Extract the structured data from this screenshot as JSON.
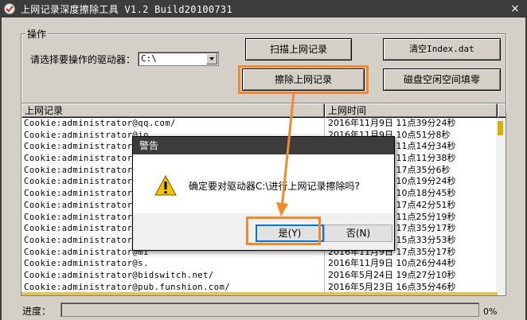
{
  "window": {
    "title": "上网记录深度擦除工具 V1.2   Build20100731",
    "close_glyph": "×"
  },
  "group": {
    "label": "操作",
    "drive_label": "请选择要操作的驱动器：",
    "drive_value": "C:\\"
  },
  "buttons": {
    "scan": "扫描上网记录",
    "clear_index": "清空Index.dat",
    "erase": "擦除上网记录",
    "wipe_free": "磁盘空闲空间填零"
  },
  "list": {
    "columns": [
      "上网记录",
      "上网时间"
    ],
    "rows": [
      {
        "url": "Cookie:administrator@qq.com/",
        "time": "2016年11月9日 11点39分24秒"
      },
      {
        "url": "Cookie:administrator@jo",
        "time": "2016年11月9日 10点51分8秒"
      },
      {
        "url": "Cookie:administrator@cn",
        "time": "2016年11月9日 11点14分34秒"
      },
      {
        "url": "Cookie:administrator@le",
        "time": "2016年11月9日 11点11分38秒"
      },
      {
        "url": "Cookie:administrator@bs",
        "time": "2016年11月9日 17点35分6秒"
      },
      {
        "url": "Cookie:administrator@se",
        "time": "2016年11月9日 10点19分24秒"
      },
      {
        "url": "Cookie:administrator@pp",
        "time": "2016年11月9日 10点18分45秒"
      },
      {
        "url": "Cookie:administrator@ku",
        "time": "2016年11月9日 17点42分51秒"
      },
      {
        "url": "Cookie:administrator@ap",
        "time": "2016年11月9日 11点25分19秒"
      },
      {
        "url": "Cookie:administrator@ww",
        "time": "2016年11月9日 17点35分17秒"
      },
      {
        "url": "Cookie:administrator@my",
        "time": "2016年11月9日 15点33分53秒"
      },
      {
        "url": "Cookie:administrator@mi",
        "time": "2016年11月9日 17点35分17秒"
      },
      {
        "url": "Cookie:administrator@s.",
        "time": "2016年11月9日 10点26分44秒"
      },
      {
        "url": "Cookie:administrator@bidswitch.net/",
        "time": "2016年5月24日 19点27分10秒"
      },
      {
        "url": "Cookie:administrator@pub.funshion.com/",
        "time": "2016年5月23日 16点35分46秒"
      },
      {
        "url": "Cookie:administrator@baifendian.com/",
        "time": "2016年11月8日 17点41分5秒"
      }
    ]
  },
  "progress": {
    "label": "进度：",
    "value": 0,
    "text": "0%"
  },
  "dialog": {
    "title": "警告",
    "message": "确定要对驱动器C:\\进行上网记录擦除吗?",
    "yes": "是(Y)",
    "no": "否(N)"
  },
  "colors": {
    "highlight": "#f08a2a",
    "titlebar": "#3c3c3c",
    "face": "#d4d0c8"
  }
}
